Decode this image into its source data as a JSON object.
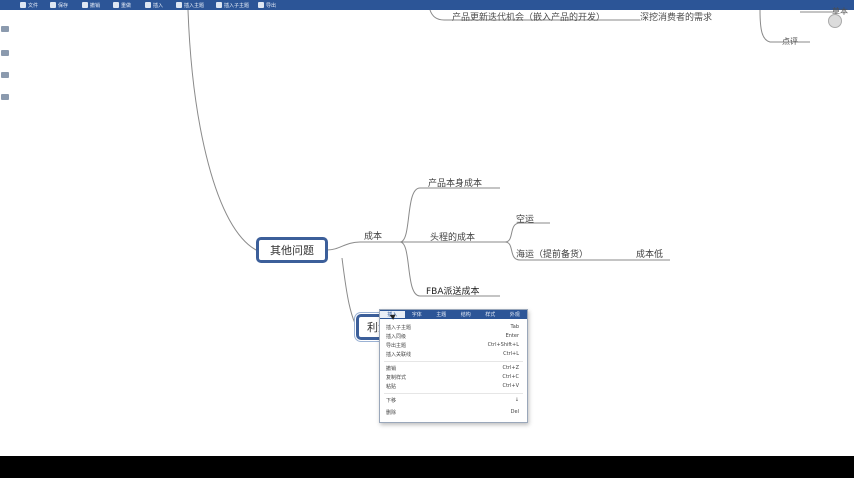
{
  "toolbar": {
    "items": [
      {
        "label": "文件"
      },
      {
        "label": "保存"
      },
      {
        "label": "撤销"
      },
      {
        "label": "重做"
      },
      {
        "label": "插入"
      },
      {
        "label": "插入主题"
      },
      {
        "label": "插入子主题"
      },
      {
        "label": "导出"
      }
    ]
  },
  "mindmap": {
    "top_fragment_left": "产品更新迭代机会（嵌入产品的开发）",
    "top_fragment_right": "深挖消费者的需求",
    "top_fragment_far": "点评",
    "top_fragment_cut": "草本",
    "central_node": "其他问题",
    "branch_cost": "成本",
    "cost_children": [
      "产品本身成本",
      "头程的成本",
      "FBA派送成本"
    ],
    "shipping_children": [
      "空运",
      "海运（提前备货）"
    ],
    "sea_note": "成本低",
    "selected_node": "利润"
  },
  "context_menu": {
    "tabs": [
      "插入",
      "字体",
      "主题",
      "结构",
      "样式",
      "外观"
    ],
    "active_tab": 0,
    "items": [
      {
        "label": "插入子主题",
        "shortcut": "Tab"
      },
      {
        "label": "插入同级",
        "shortcut": "Enter"
      },
      {
        "label": "导出主题",
        "shortcut": "Ctrl+Shift+L"
      },
      {
        "label": "插入关联线",
        "shortcut": "Ctrl+L"
      },
      {
        "label": "撤销",
        "shortcut": "Ctrl+Z"
      },
      {
        "label": "复制样式",
        "shortcut": "Ctrl+C"
      },
      {
        "label": "粘贴",
        "shortcut": "Ctrl+V"
      },
      {
        "label": "下移",
        "shortcut": "↓"
      },
      {
        "label": "删除",
        "shortcut": "Del"
      }
    ]
  },
  "colors": {
    "toolbar_bg": "#2c5597",
    "node_border": "#3c5f9a",
    "line": "#8a8a8a"
  }
}
